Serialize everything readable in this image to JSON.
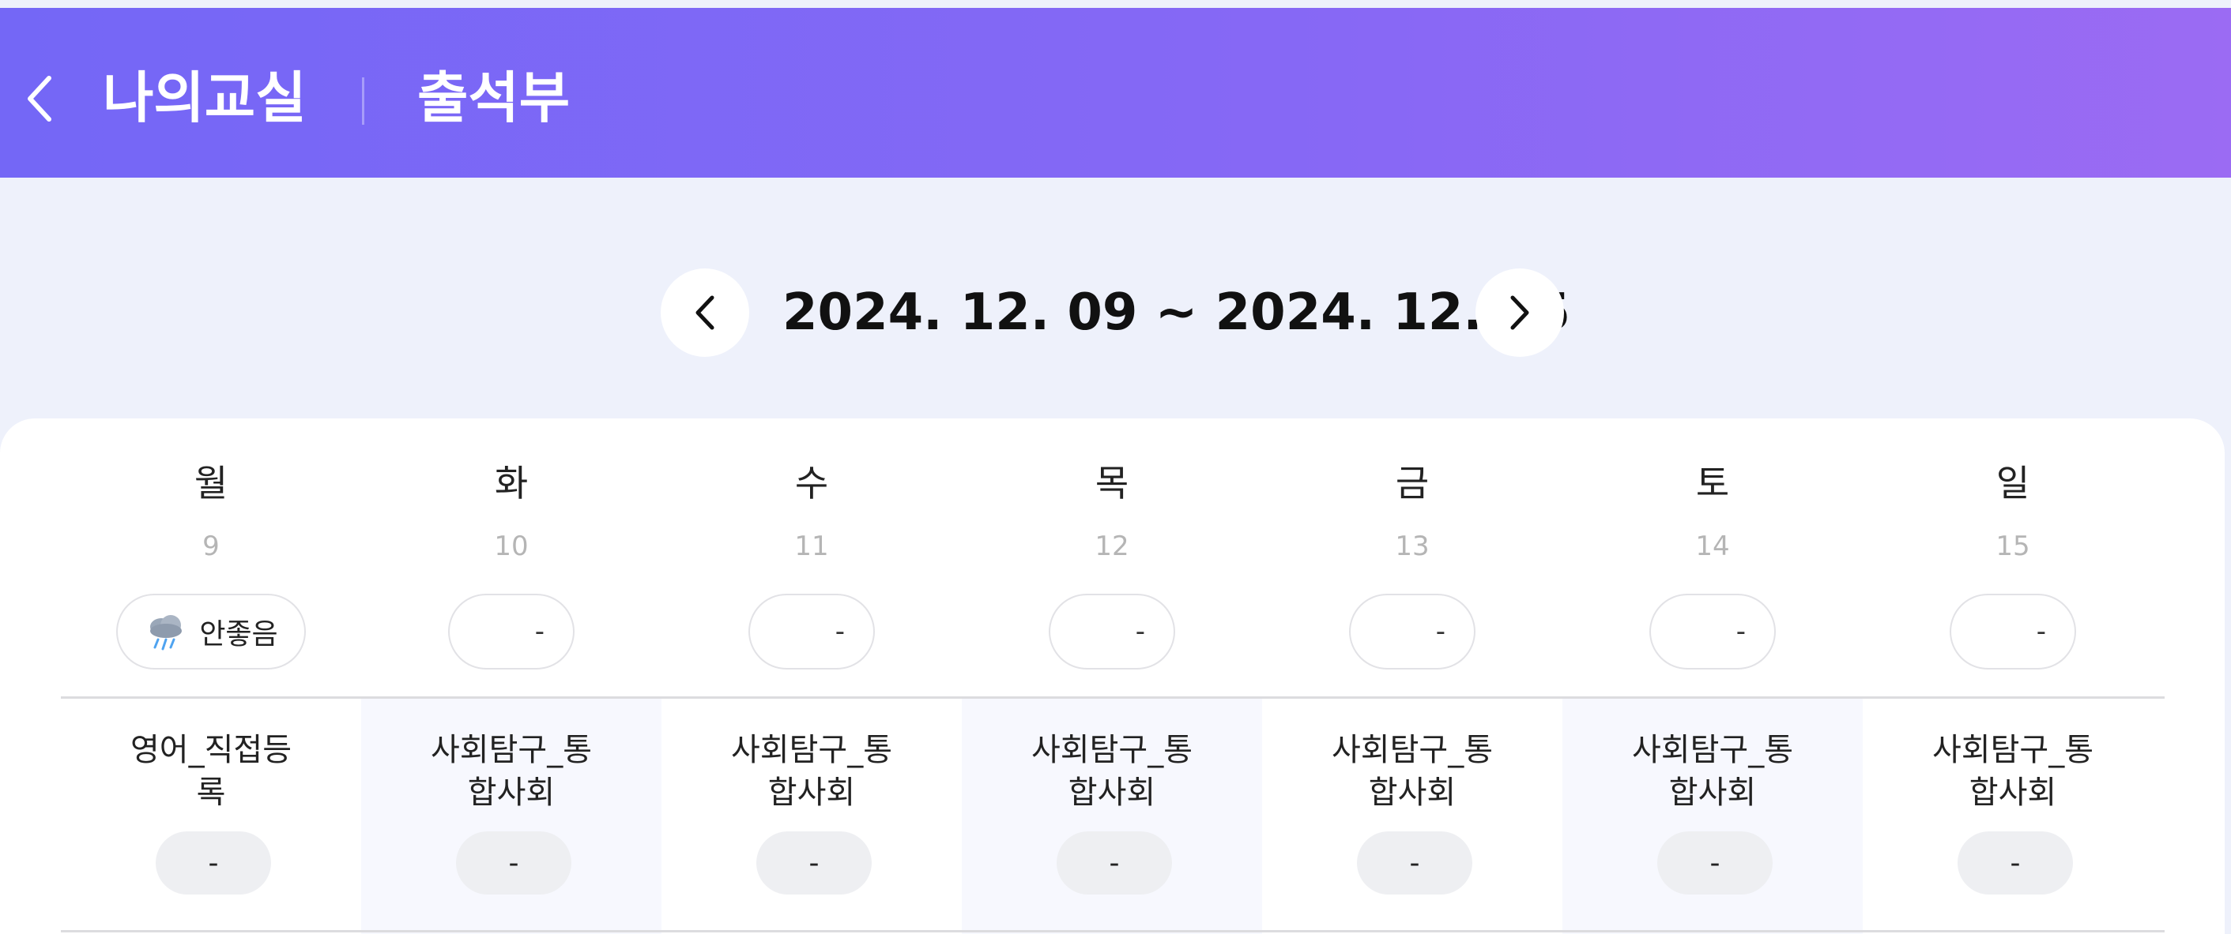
{
  "header": {
    "back_icon": "chevron-left-icon",
    "breadcrumb_parent": "나의교실",
    "breadcrumb_current": "출석부"
  },
  "week": {
    "range": "2024. 12. 09 ~ 2024. 12. 15",
    "prev_icon": "chevron-left-icon",
    "next_icon": "chevron-right-icon"
  },
  "days": [
    {
      "name": "월",
      "date": "9",
      "weather_icon": "rain-cloud-icon",
      "weather": "안좋음",
      "subject": "영어_직접등\n록",
      "status": "-"
    },
    {
      "name": "화",
      "date": "10",
      "weather": "-",
      "subject": "사회탐구_통\n합사회",
      "status": "-"
    },
    {
      "name": "수",
      "date": "11",
      "weather": "-",
      "subject": "사회탐구_통\n합사회",
      "status": "-"
    },
    {
      "name": "목",
      "date": "12",
      "weather": "-",
      "subject": "사회탐구_통\n합사회",
      "status": "-"
    },
    {
      "name": "금",
      "date": "13",
      "weather": "-",
      "subject": "사회탐구_통\n합사회",
      "status": "-"
    },
    {
      "name": "토",
      "date": "14",
      "weather": "-",
      "subject": "사회탐구_통\n합사회",
      "status": "-"
    },
    {
      "name": "일",
      "date": "15",
      "weather": "-",
      "subject": "사회탐구_통\n합사회",
      "status": "-"
    }
  ],
  "colors": {
    "header_gradient_start": "#7467f6",
    "header_gradient_end": "#9b6bf3",
    "page_background": "#eef1fb",
    "shaded_column": "#f7f8fe",
    "status_pill": "#eeeff2"
  }
}
